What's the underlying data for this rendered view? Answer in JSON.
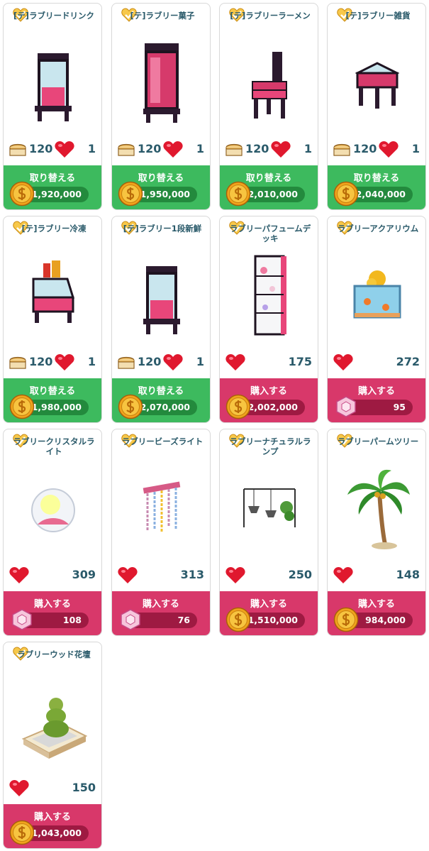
{
  "items": [
    {
      "name": "[テ]ラブリードリンク",
      "bread": "120",
      "love": "1",
      "button": "取り替える",
      "price": "1,920,000",
      "currency": "coin",
      "art": "cabinet-glass"
    },
    {
      "name": "[テ]ラブリー菓子",
      "bread": "120",
      "love": "1",
      "button": "取り替える",
      "price": "1,950,000",
      "currency": "coin",
      "art": "tall-cabinet"
    },
    {
      "name": "[テ]ラブリーラーメン",
      "bread": "120",
      "love": "1",
      "button": "取り替える",
      "price": "2,010,000",
      "currency": "coin",
      "art": "chair"
    },
    {
      "name": "[テ]ラブリー雑貨",
      "bread": "120",
      "love": "1",
      "button": "取り替える",
      "price": "2,040,000",
      "currency": "coin",
      "art": "table-case"
    },
    {
      "name": "[テ]ラブリー冷凍",
      "bread": "120",
      "love": "1",
      "button": "取り替える",
      "price": "1,980,000",
      "currency": "coin",
      "art": "freezer"
    },
    {
      "name": "[テ]ラブリー1段新鮮",
      "bread": "120",
      "love": "1",
      "button": "取り替える",
      "price": "2,070,000",
      "currency": "coin",
      "art": "cabinet-glass"
    },
    {
      "name": "ラブリーパフュームデッキ",
      "bread": "",
      "love": "175",
      "button": "購入する",
      "price": "2,002,000",
      "currency": "coin",
      "art": "shelf"
    },
    {
      "name": "ラブリーアクアリウム",
      "bread": "",
      "love": "272",
      "button": "購入する",
      "price": "95",
      "currency": "gem",
      "art": "aquarium"
    },
    {
      "name": "ラブリークリスタルライト",
      "bread": "",
      "love": "309",
      "button": "購入する",
      "price": "108",
      "currency": "gem",
      "art": "crystal"
    },
    {
      "name": "ラブリービーズライト",
      "bread": "",
      "love": "313",
      "button": "購入する",
      "price": "76",
      "currency": "gem",
      "art": "beads"
    },
    {
      "name": "ラブリーナチュラルランプ",
      "bread": "",
      "love": "250",
      "button": "購入する",
      "price": "1,510,000",
      "currency": "coin",
      "art": "lamps"
    },
    {
      "name": "ラブリーパームツリー",
      "bread": "",
      "love": "148",
      "button": "購入する",
      "price": "984,000",
      "currency": "coin",
      "art": "palm"
    },
    {
      "name": "ラブリーウッド花壇",
      "bread": "",
      "love": "150",
      "button": "購入する",
      "price": "1,043,000",
      "currency": "coin",
      "art": "planter"
    }
  ],
  "colors": {
    "exchange": "#3dba5e",
    "buy": "#d8386a",
    "text": "#2a5a6a"
  },
  "icons": {
    "badge": "heart-badge-icon",
    "bread": "bread-icon",
    "love": "heart-icon",
    "coin": "coin-icon",
    "gem": "gem-icon"
  }
}
